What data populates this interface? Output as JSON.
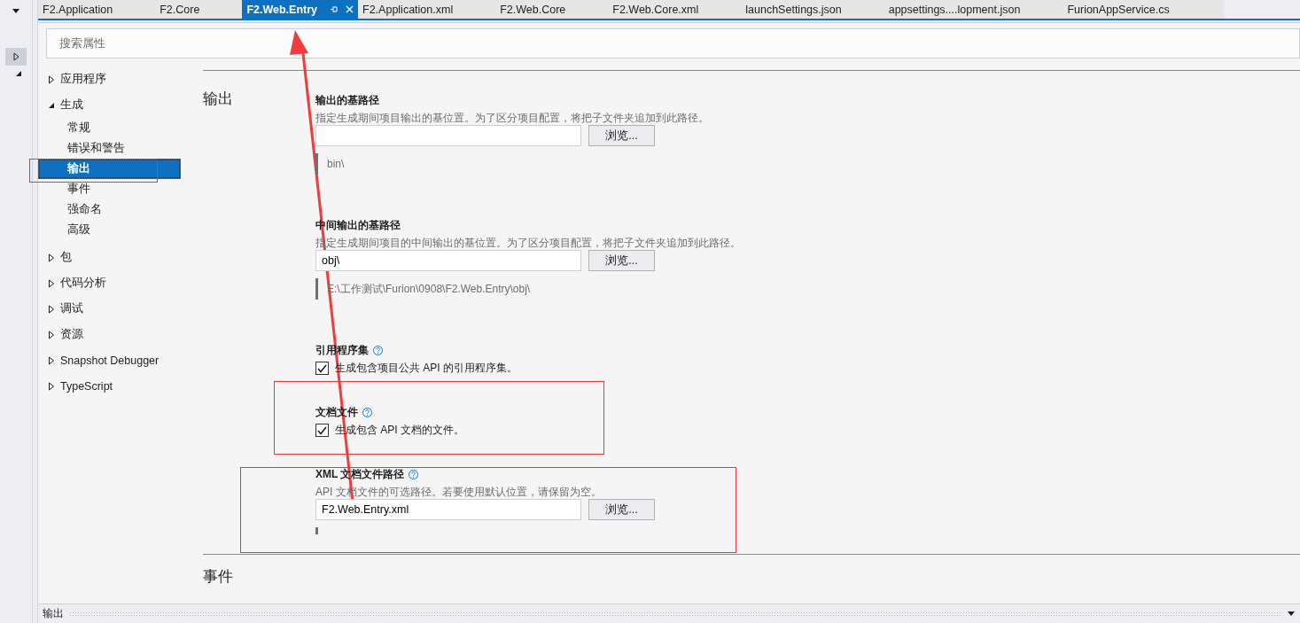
{
  "tabs": [
    {
      "label": "F2.Application",
      "selected": false
    },
    {
      "label": "F2.Core",
      "selected": false
    },
    {
      "label": "F2.Web.Entry",
      "selected": true
    },
    {
      "label": "F2.Application.xml",
      "selected": false
    },
    {
      "label": "F2.Web.Core",
      "selected": false
    },
    {
      "label": "F2.Web.Core.xml",
      "selected": false
    },
    {
      "label": "launchSettings.json",
      "selected": false
    },
    {
      "label": "appsettings....lopment.json",
      "selected": false
    },
    {
      "label": "FurionAppService.cs",
      "selected": false
    }
  ],
  "search": {
    "placeholder": "搜索属性"
  },
  "sidebar": {
    "items": [
      {
        "label": "应用程序",
        "expanded": false
      },
      {
        "label": "生成",
        "expanded": true,
        "children": [
          {
            "label": "常规",
            "selected": false
          },
          {
            "label": "错误和警告",
            "selected": false
          },
          {
            "label": "输出",
            "selected": true
          },
          {
            "label": "事件",
            "selected": false
          },
          {
            "label": "强命名",
            "selected": false
          },
          {
            "label": "高级",
            "selected": false
          }
        ]
      },
      {
        "label": "包",
        "expanded": false
      },
      {
        "label": "代码分析",
        "expanded": false
      },
      {
        "label": "调试",
        "expanded": false
      },
      {
        "label": "资源",
        "expanded": false
      },
      {
        "label": "Snapshot Debugger",
        "expanded": false
      },
      {
        "label": "TypeScript",
        "expanded": false
      }
    ]
  },
  "section": {
    "title": "输出",
    "properties": [
      {
        "kind": "path",
        "title": "输出的基路径",
        "description": "指定生成期间项目输出的基位置。为了区分项目配置，将把子文件夹追加到此路径。",
        "button": "浏览...",
        "resolved": "bin\\"
      },
      {
        "kind": "path",
        "title": "中间输出的基路径",
        "description": "指定生成期间项目的中间输出的基位置。为了区分项目配置，将把子文件夹追加到此路径。",
        "value": "obj\\",
        "button": "浏览...",
        "resolved": "E:\\工作测试\\Furion\\0908\\F2.Web.Entry\\obj\\"
      },
      {
        "kind": "checkbox",
        "title": "引用程序集",
        "help": true,
        "label": "生成包含项目公共 API 的引用程序集。",
        "checked": true
      },
      {
        "kind": "checkbox",
        "title": "文档文件",
        "help": true,
        "label": "生成包含 API 文档的文件。",
        "checked": true
      },
      {
        "kind": "path",
        "title": "XML 文档文件路径",
        "help": true,
        "description": "API 文档文件的可选路径。若要使用默认位置，请保留为空。",
        "value": "F2.Web.Entry.xml",
        "button": "浏览..."
      }
    ]
  },
  "next_section": {
    "title": "事件"
  },
  "output_bar": {
    "title": "输出"
  }
}
